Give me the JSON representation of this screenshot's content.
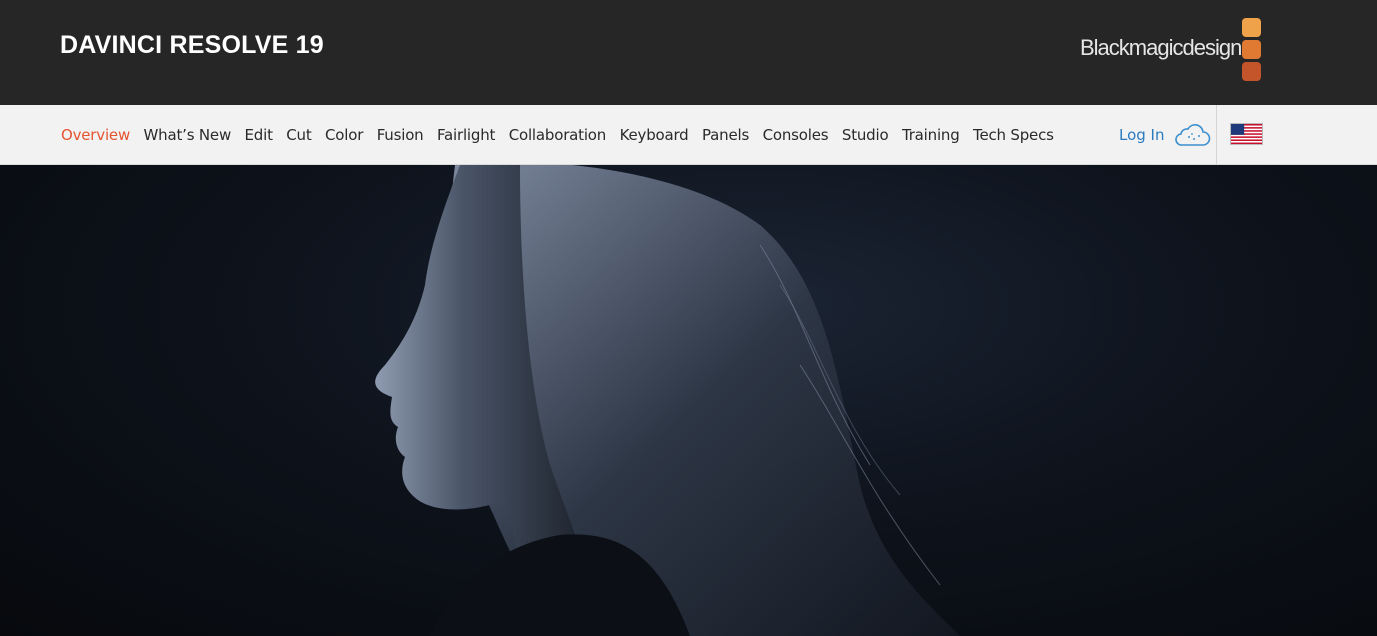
{
  "header": {
    "product_title": "DAVINCI RESOLVE 19",
    "brand": {
      "text": "Blackmagicdesign",
      "square_colors": [
        "#f0a24a",
        "#e07a33",
        "#c4542a"
      ]
    }
  },
  "nav": {
    "items": [
      {
        "label": "Overview",
        "active": true
      },
      {
        "label": "What’s New"
      },
      {
        "label": "Edit"
      },
      {
        "label": "Cut"
      },
      {
        "label": "Color"
      },
      {
        "label": "Fusion"
      },
      {
        "label": "Fairlight"
      },
      {
        "label": "Collaboration"
      },
      {
        "label": "Keyboard"
      },
      {
        "label": "Panels"
      },
      {
        "label": "Consoles"
      },
      {
        "label": "Studio"
      },
      {
        "label": "Training"
      },
      {
        "label": "Tech Specs"
      }
    ],
    "login_label": "Log In",
    "login_icon": "cloud-icon",
    "region_icon": "us-flag-icon"
  },
  "colors": {
    "topbar": "#262626",
    "navbar": "#f2f2f2",
    "accent": "#e5542f",
    "link": "#2a7bbf"
  }
}
